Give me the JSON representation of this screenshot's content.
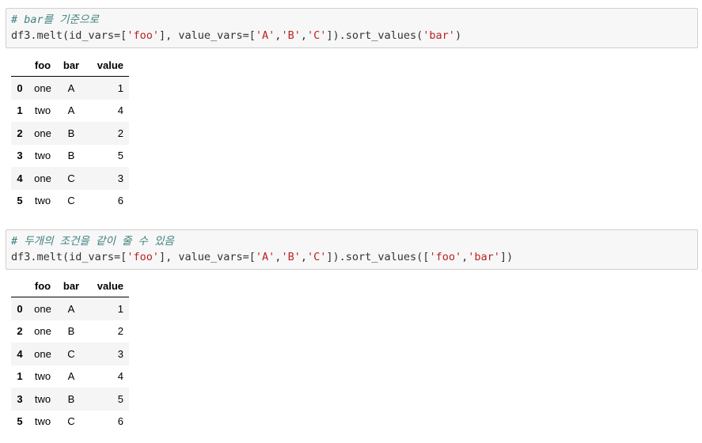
{
  "cells": [
    {
      "comment": "# bar를 기준으로",
      "code": {
        "prefix": "df3.melt(id_vars=",
        "idvars_open": "[",
        "idvars_str": "'foo'",
        "idvars_close": "]",
        "mid": ", value_vars=",
        "vv_open": "[",
        "vv_a": "'A'",
        "c1": ",",
        "vv_b": "'B'",
        "c2": ",",
        "vv_c": "'C'",
        "vv_close": "]",
        "method": ").sort_values(",
        "arg": "'bar'",
        "end": ")"
      },
      "table": {
        "columns": [
          "foo",
          "bar",
          "value"
        ],
        "rows": [
          {
            "index": "0",
            "foo": "one",
            "bar": "A",
            "value": "1"
          },
          {
            "index": "1",
            "foo": "two",
            "bar": "A",
            "value": "4"
          },
          {
            "index": "2",
            "foo": "one",
            "bar": "B",
            "value": "2"
          },
          {
            "index": "3",
            "foo": "two",
            "bar": "B",
            "value": "5"
          },
          {
            "index": "4",
            "foo": "one",
            "bar": "C",
            "value": "3"
          },
          {
            "index": "5",
            "foo": "two",
            "bar": "C",
            "value": "6"
          }
        ]
      }
    },
    {
      "comment": "# 두개의 조건을 같이 줄 수 있음",
      "code": {
        "prefix": "df3.melt(id_vars=",
        "idvars_open": "[",
        "idvars_str": "'foo'",
        "idvars_close": "]",
        "mid": ", value_vars=",
        "vv_open": "[",
        "vv_a": "'A'",
        "c1": ",",
        "vv_b": "'B'",
        "c2": ",",
        "vv_c": "'C'",
        "vv_close": "]",
        "method": ").sort_values(",
        "arg_open": "[",
        "arg1": "'foo'",
        "argc": ",",
        "arg2": "'bar'",
        "arg_close": "]",
        "end": ")"
      },
      "table": {
        "columns": [
          "foo",
          "bar",
          "value"
        ],
        "rows": [
          {
            "index": "0",
            "foo": "one",
            "bar": "A",
            "value": "1"
          },
          {
            "index": "2",
            "foo": "one",
            "bar": "B",
            "value": "2"
          },
          {
            "index": "4",
            "foo": "one",
            "bar": "C",
            "value": "3"
          },
          {
            "index": "1",
            "foo": "two",
            "bar": "A",
            "value": "4"
          },
          {
            "index": "3",
            "foo": "two",
            "bar": "B",
            "value": "5"
          },
          {
            "index": "5",
            "foo": "two",
            "bar": "C",
            "value": "6"
          }
        ]
      }
    }
  ],
  "colors": {
    "comment": "#408080",
    "string": "#ba2121",
    "cell_background": "#f7f7f7",
    "cell_border": "#cfcfcf"
  }
}
